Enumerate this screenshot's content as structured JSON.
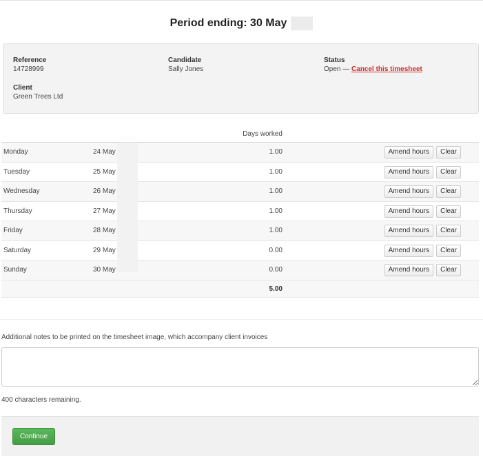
{
  "header": {
    "title": "Period ending: 30 May"
  },
  "info": {
    "reference_label": "Reference",
    "reference_value": "14728999",
    "candidate_label": "Candidate",
    "candidate_value": "Sally Jones",
    "status_label": "Status",
    "status_value": "Open —",
    "cancel_link": "Cancel this timesheet",
    "client_label": "Client",
    "client_value": "Green Trees Ltd"
  },
  "grid": {
    "days_worked_header": "Days worked",
    "amend_label": "Amend hours",
    "clear_label": "Clear",
    "rows": [
      {
        "day": "Monday",
        "date": "24 May",
        "days": "1.00"
      },
      {
        "day": "Tuesday",
        "date": "25 May",
        "days": "1.00"
      },
      {
        "day": "Wednesday",
        "date": "26 May",
        "days": "1.00"
      },
      {
        "day": "Thursday",
        "date": "27 May",
        "days": "1.00"
      },
      {
        "day": "Friday",
        "date": "28 May",
        "days": "1.00"
      },
      {
        "day": "Saturday",
        "date": "29 May",
        "days": "0.00"
      },
      {
        "day": "Sunday",
        "date": "30 May",
        "days": "0.00"
      }
    ],
    "total": "5.00"
  },
  "notes": {
    "label": "Additional notes to be printed on the timesheet image, which accompany client invoices",
    "value": "",
    "remaining": "400 characters remaining."
  },
  "footer": {
    "continue_label": "Continue"
  },
  "colors": {
    "accent_green": "#5cb85c",
    "link_red": "#c9302c",
    "panel_grey": "#f3f3f3"
  }
}
